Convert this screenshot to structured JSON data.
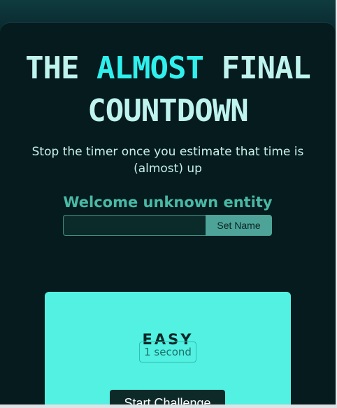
{
  "title": {
    "line1_prefix": "THE ",
    "line1_accent": "ALMOST",
    "line1_suffix": " FINAL",
    "line2": "COUNTDOWN"
  },
  "subtitle": "Stop the timer once you estimate that time is (almost) up",
  "welcome": "Welcome unknown entity",
  "name_form": {
    "input_value": "",
    "input_placeholder": "",
    "button_label": "Set Name"
  },
  "challenge": {
    "difficulty": "EASY",
    "duration": "1 second",
    "start_label": "Start Challenge"
  },
  "colors": {
    "background": "#061b1e",
    "title": "#bff3ee",
    "accent": "#2ff0ec",
    "welcome": "#49b9a6",
    "card": "#52f1e2",
    "button": "#0d2a29"
  }
}
